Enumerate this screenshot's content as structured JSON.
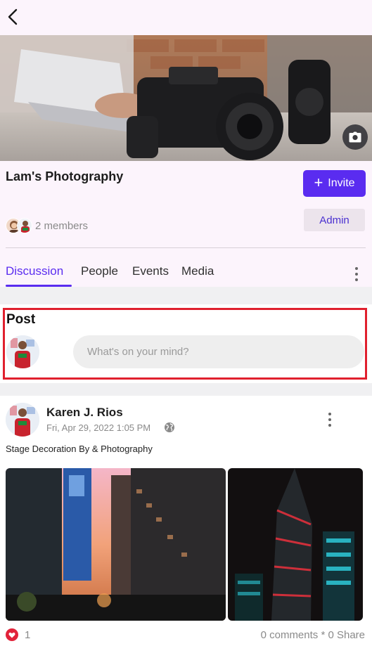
{
  "group": {
    "title": "Lam's Photography",
    "members_text": "2 members",
    "invite_label": "Invite",
    "admin_label": "Admin"
  },
  "tabs": [
    {
      "label": "Discussion",
      "active": true
    },
    {
      "label": "People",
      "active": false
    },
    {
      "label": "Events",
      "active": false
    },
    {
      "label": "Media",
      "active": false
    }
  ],
  "composer": {
    "title": "Post",
    "placeholder": "What's on your mind?"
  },
  "feed": {
    "post": {
      "author": "Karen J. Rios",
      "timestamp": "Fri, Apr 29, 2022 1:05 PM",
      "caption": "Stage Decoration By & Photography",
      "likes": "1",
      "stats": "0 comments * 0 Share"
    }
  },
  "icons": {
    "back": "back-arrow-icon",
    "camera": "camera-icon",
    "plus": "plus-icon",
    "more": "more-vertical-icon",
    "globe": "globe-icon",
    "like": "heart-icon"
  },
  "colors": {
    "accent": "#5a2cf0",
    "header_bg": "#fcf4fc",
    "highlight": "#e0202e",
    "like": "#e2233a"
  }
}
